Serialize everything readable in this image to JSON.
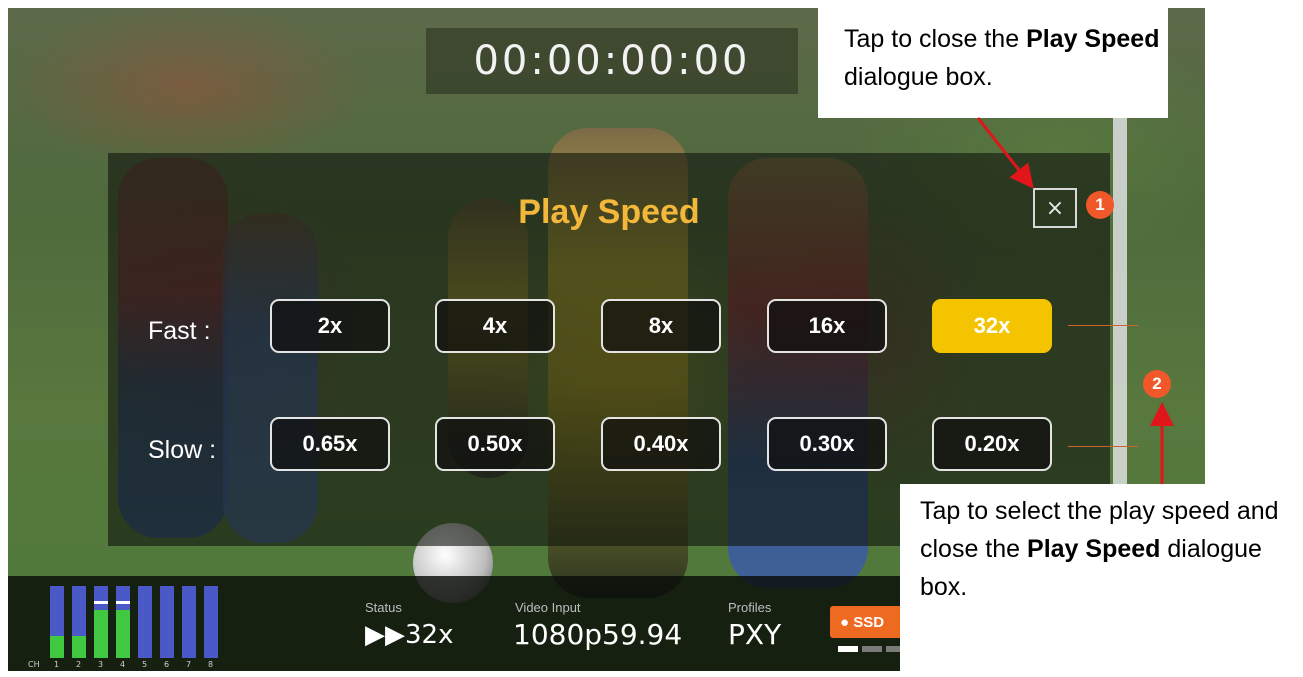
{
  "timecode": "00:00:00:00",
  "dialog": {
    "title": "Play Speed",
    "close_glyph": "×",
    "fast_label": "Fast :",
    "slow_label": "Slow :",
    "fast_options": [
      "2x",
      "4x",
      "8x",
      "16x",
      "32x"
    ],
    "slow_options": [
      "0.65x",
      "0.50x",
      "0.40x",
      "0.30x",
      "0.20x"
    ],
    "selected_option": "32x",
    "selected_color": "#f5c400"
  },
  "badges": {
    "close": "1",
    "speed": "2"
  },
  "status_bar": {
    "status_label": "Status",
    "status_value": "▶▶32x",
    "video_input_label": "Video Input",
    "video_input_value": "1080p59.94",
    "profiles_label": "Profiles",
    "profiles_value": "PXY",
    "ssd_label": "● SSD",
    "audio_channel_labels": [
      "CH",
      "1",
      "2",
      "3",
      "4",
      "5",
      "6",
      "7",
      "8"
    ]
  },
  "annotations": {
    "close_note_prefix": "Tap to close the ",
    "close_note_bold": "Play Speed",
    "close_note_suffix": " dialogue box.",
    "select_note_prefix": "Tap to select the play speed and close the ",
    "select_note_bold": "Play Speed",
    "select_note_suffix": " dialogue box."
  },
  "colors": {
    "accent_title": "#f3b73c",
    "badge": "#f0582a",
    "arrow": "#e0161a"
  }
}
